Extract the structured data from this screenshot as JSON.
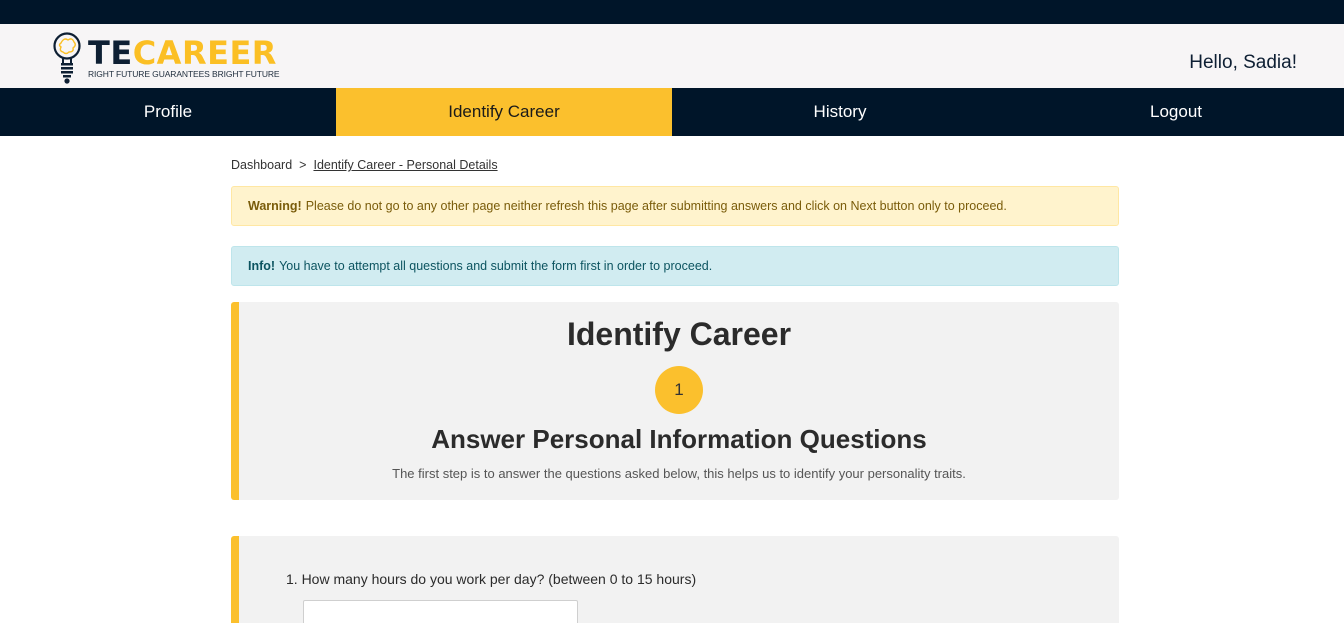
{
  "brand": {
    "name_part1": "TE",
    "name_part2": "CAREER",
    "tagline": "RIGHT FUTURE GUARANTEES BRIGHT FUTURE",
    "accent_color": "#fbc02d",
    "dark_color": "#001529"
  },
  "header": {
    "greeting": "Hello, Sadia!"
  },
  "nav": {
    "items": [
      {
        "label": "Profile"
      },
      {
        "label": "Identify Career",
        "active": true
      },
      {
        "label": "History"
      },
      {
        "label": "Logout"
      }
    ]
  },
  "breadcrumb": {
    "root": "Dashboard",
    "separator": ">",
    "current": "Identify Career - Personal Details"
  },
  "alerts": {
    "warning": {
      "title": "Warning!",
      "text": "Please do not go to any other page neither refresh this page after submitting answers and click on Next button only to proceed."
    },
    "info": {
      "title": "Info!",
      "text": "You have to attempt all questions and submit the form first in order to proceed."
    }
  },
  "step": {
    "title": "Identify Career",
    "number": "1",
    "heading": "Answer Personal Information Questions",
    "description": "The first step is to answer the questions asked below, this helps us to identify your personality traits."
  },
  "questions": [
    {
      "label": "1. How many hours do you work per day? (between 0 to 15 hours)",
      "value": ""
    }
  ],
  "icons": {
    "logo": "lightbulb-brain-icon"
  }
}
